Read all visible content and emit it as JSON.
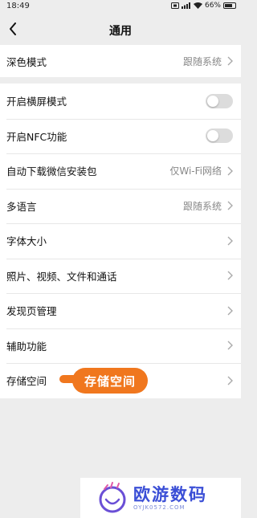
{
  "status_bar": {
    "time": "18:49",
    "battery": "66%"
  },
  "nav": {
    "title": "通用"
  },
  "groups": [
    {
      "items": [
        {
          "label": "深色模式",
          "value": "跟随系统",
          "control": "chevron"
        }
      ]
    },
    {
      "items": [
        {
          "label": "开启横屏模式",
          "control": "toggle",
          "on": false
        },
        {
          "label": "开启NFC功能",
          "control": "toggle",
          "on": false
        },
        {
          "label": "自动下载微信安装包",
          "value": "仅Wi-Fi网络",
          "control": "chevron"
        },
        {
          "label": "多语言",
          "value": "跟随系统",
          "control": "chevron"
        },
        {
          "label": "字体大小",
          "control": "chevron"
        },
        {
          "label": "照片、视频、文件和通话",
          "control": "chevron"
        },
        {
          "label": "发现页管理",
          "control": "chevron"
        },
        {
          "label": "辅助功能",
          "control": "chevron"
        },
        {
          "label": "存储空间",
          "control": "chevron"
        }
      ]
    }
  ],
  "annotation": {
    "badge_text": "存储空间",
    "color": "#f0771e"
  },
  "watermark": {
    "title": "欧游数码",
    "subtitle": "OYJK0572.COM"
  },
  "colors": {
    "background": "#ededed",
    "toggle_off": "#dcdcdc",
    "secondary_text": "#888888",
    "watermark_blue": "#3b4fd6"
  }
}
